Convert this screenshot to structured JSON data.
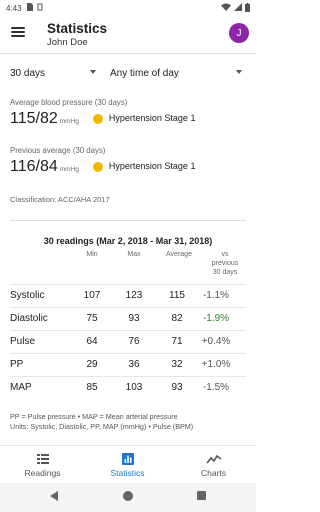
{
  "status_bar": {
    "time": "4:43"
  },
  "app_bar": {
    "title": "Statistics",
    "subtitle": "John Doe",
    "avatar_letter": "J",
    "avatar_color": "#8e24aa"
  },
  "filters": {
    "period": "30 days",
    "time_of_day": "Any time of day"
  },
  "current": {
    "label": "Average blood pressure (30 days)",
    "value": "115/82",
    "unit": "mmHg",
    "stage": "Hypertension Stage 1",
    "stage_color": "#f5b800"
  },
  "previous": {
    "label": "Previous average (30 days)",
    "value": "116/84",
    "unit": "mmHg",
    "stage": "Hypertension Stage 1",
    "stage_color": "#f5b800"
  },
  "classification": "Classification: ACC/AHA 2017",
  "table": {
    "title": "30 readings (Mar 2, 2018 - Mar 31, 2018)",
    "headers": {
      "min": "Min",
      "max": "Max",
      "average": "Average",
      "vs_line1": "vs",
      "vs_line2": "previous",
      "vs_line3": "30 days"
    },
    "rows": [
      {
        "name": "Systolic",
        "min": "107",
        "max": "123",
        "avg": "115",
        "vs": "-1.1%",
        "vs_color": "#555555"
      },
      {
        "name": "Diastolic",
        "min": "75",
        "max": "93",
        "avg": "82",
        "vs": "-1.9%",
        "vs_color": "#2e7d32"
      },
      {
        "name": "Pulse",
        "min": "64",
        "max": "76",
        "avg": "71",
        "vs": "+0.4%",
        "vs_color": "#555555"
      },
      {
        "name": "PP",
        "min": "29",
        "max": "36",
        "avg": "32",
        "vs": "+1.0%",
        "vs_color": "#555555"
      },
      {
        "name": "MAP",
        "min": "85",
        "max": "103",
        "avg": "93",
        "vs": "-1.5%",
        "vs_color": "#555555"
      }
    ]
  },
  "footnote": {
    "line1": "PP = Pulse pressure • MAP = Mean arterial pressure",
    "line2": "Units: Systolic, Diastolic, PP, MAP (mmHg) • Pulse (BPM)"
  },
  "bottom_nav": {
    "readings": "Readings",
    "statistics": "Statistics",
    "charts": "Charts",
    "active_color": "#1976d2"
  }
}
